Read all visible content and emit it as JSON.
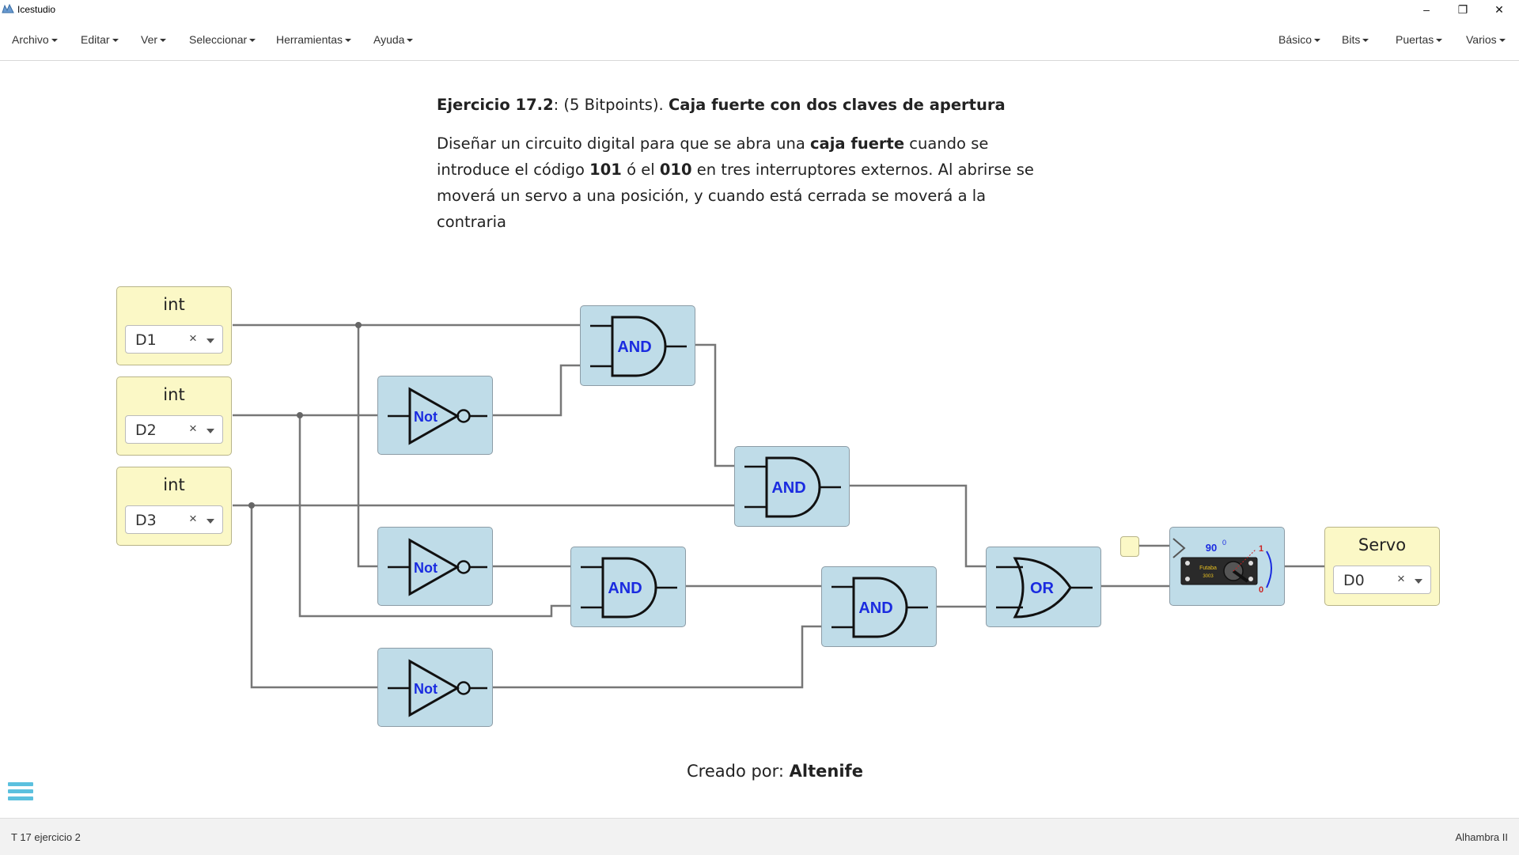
{
  "window": {
    "title": "Icestudio",
    "minimize": "–",
    "restore": "❐",
    "close": "✕"
  },
  "menu": {
    "left": [
      "Archivo",
      "Editar",
      "Ver",
      "Seleccionar",
      "Herramientas",
      "Ayuda"
    ],
    "right": [
      "Básico",
      "Bits",
      "Puertas",
      "Varios"
    ]
  },
  "info": {
    "heading_bold1": "Ejercicio 17.2",
    "heading_plain": ": (5 Bitpoints). ",
    "heading_bold2": "Caja fuerte con dos claves de apertura",
    "p_1": "Diseñar un circuito digital para que se abra una ",
    "p_b1": "caja fuerte",
    "p_2": " cuando se introduce el código ",
    "p_b2": "101",
    "p_3": " ó el ",
    "p_b3": "010",
    "p_4": " en tres interruptores externos. Al abrirse se moverá un servo a una posición, y cuando está cerrada se moverá a la contraria"
  },
  "inputs": [
    {
      "label": "int",
      "pin": "D1"
    },
    {
      "label": "int",
      "pin": "D2"
    },
    {
      "label": "int",
      "pin": "D3"
    }
  ],
  "output": {
    "label": "Servo",
    "pin": "D0"
  },
  "gates": {
    "and": "AND",
    "not": "Not",
    "or": "OR"
  },
  "servo": {
    "angle": "90",
    "degree": "0",
    "one": "1",
    "zero": "0",
    "brand": "Futaba",
    "model": "3003"
  },
  "credit": {
    "prefix": "Creado por: ",
    "author": "Altenife"
  },
  "status": {
    "left": "T 17 ejercicio 2",
    "right": "Alhambra II"
  },
  "colors": {
    "gate_fill": "#bfdce8",
    "io_fill": "#fbf8c6",
    "gate_text": "#1a2be0",
    "wire": "#777777",
    "hamburger": "#5bc0de"
  }
}
